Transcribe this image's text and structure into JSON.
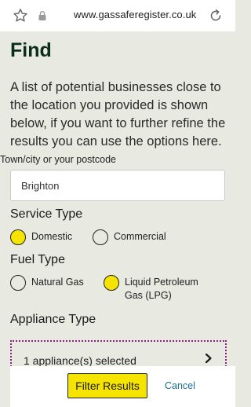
{
  "browser": {
    "url": "www.gassaferegister.co.uk",
    "icons": [
      "star-icon",
      "lock-icon",
      "reload-icon"
    ]
  },
  "page": {
    "title": "Find",
    "intro": "A list of potential businesses close to the location you provided is shown below, if you want to further refine the results you can use the options here."
  },
  "location": {
    "label": "Town/city or your postcode",
    "value": "Brighton"
  },
  "service_type": {
    "heading": "Service Type",
    "options": [
      {
        "label": "Domestic",
        "checked": true
      },
      {
        "label": "Commercial",
        "checked": false
      }
    ]
  },
  "fuel_type": {
    "heading": "Fuel Type",
    "options": [
      {
        "label": "Natural Gas",
        "checked": false
      },
      {
        "label": "Liquid Petroleum Gas (LPG)",
        "checked": true
      }
    ]
  },
  "appliance_type": {
    "heading": "Appliance Type",
    "summary": "1 appliance(s) selected"
  },
  "actions": {
    "filter_label": "Filter Results",
    "cancel_label": "Cancel"
  },
  "colors": {
    "accent_yellow": "#f5e400",
    "title_green": "#0b2e1b",
    "link_blue": "#1b6d8f",
    "focus_purple": "#8b1d8b",
    "page_bg": "#e8e9e1"
  }
}
